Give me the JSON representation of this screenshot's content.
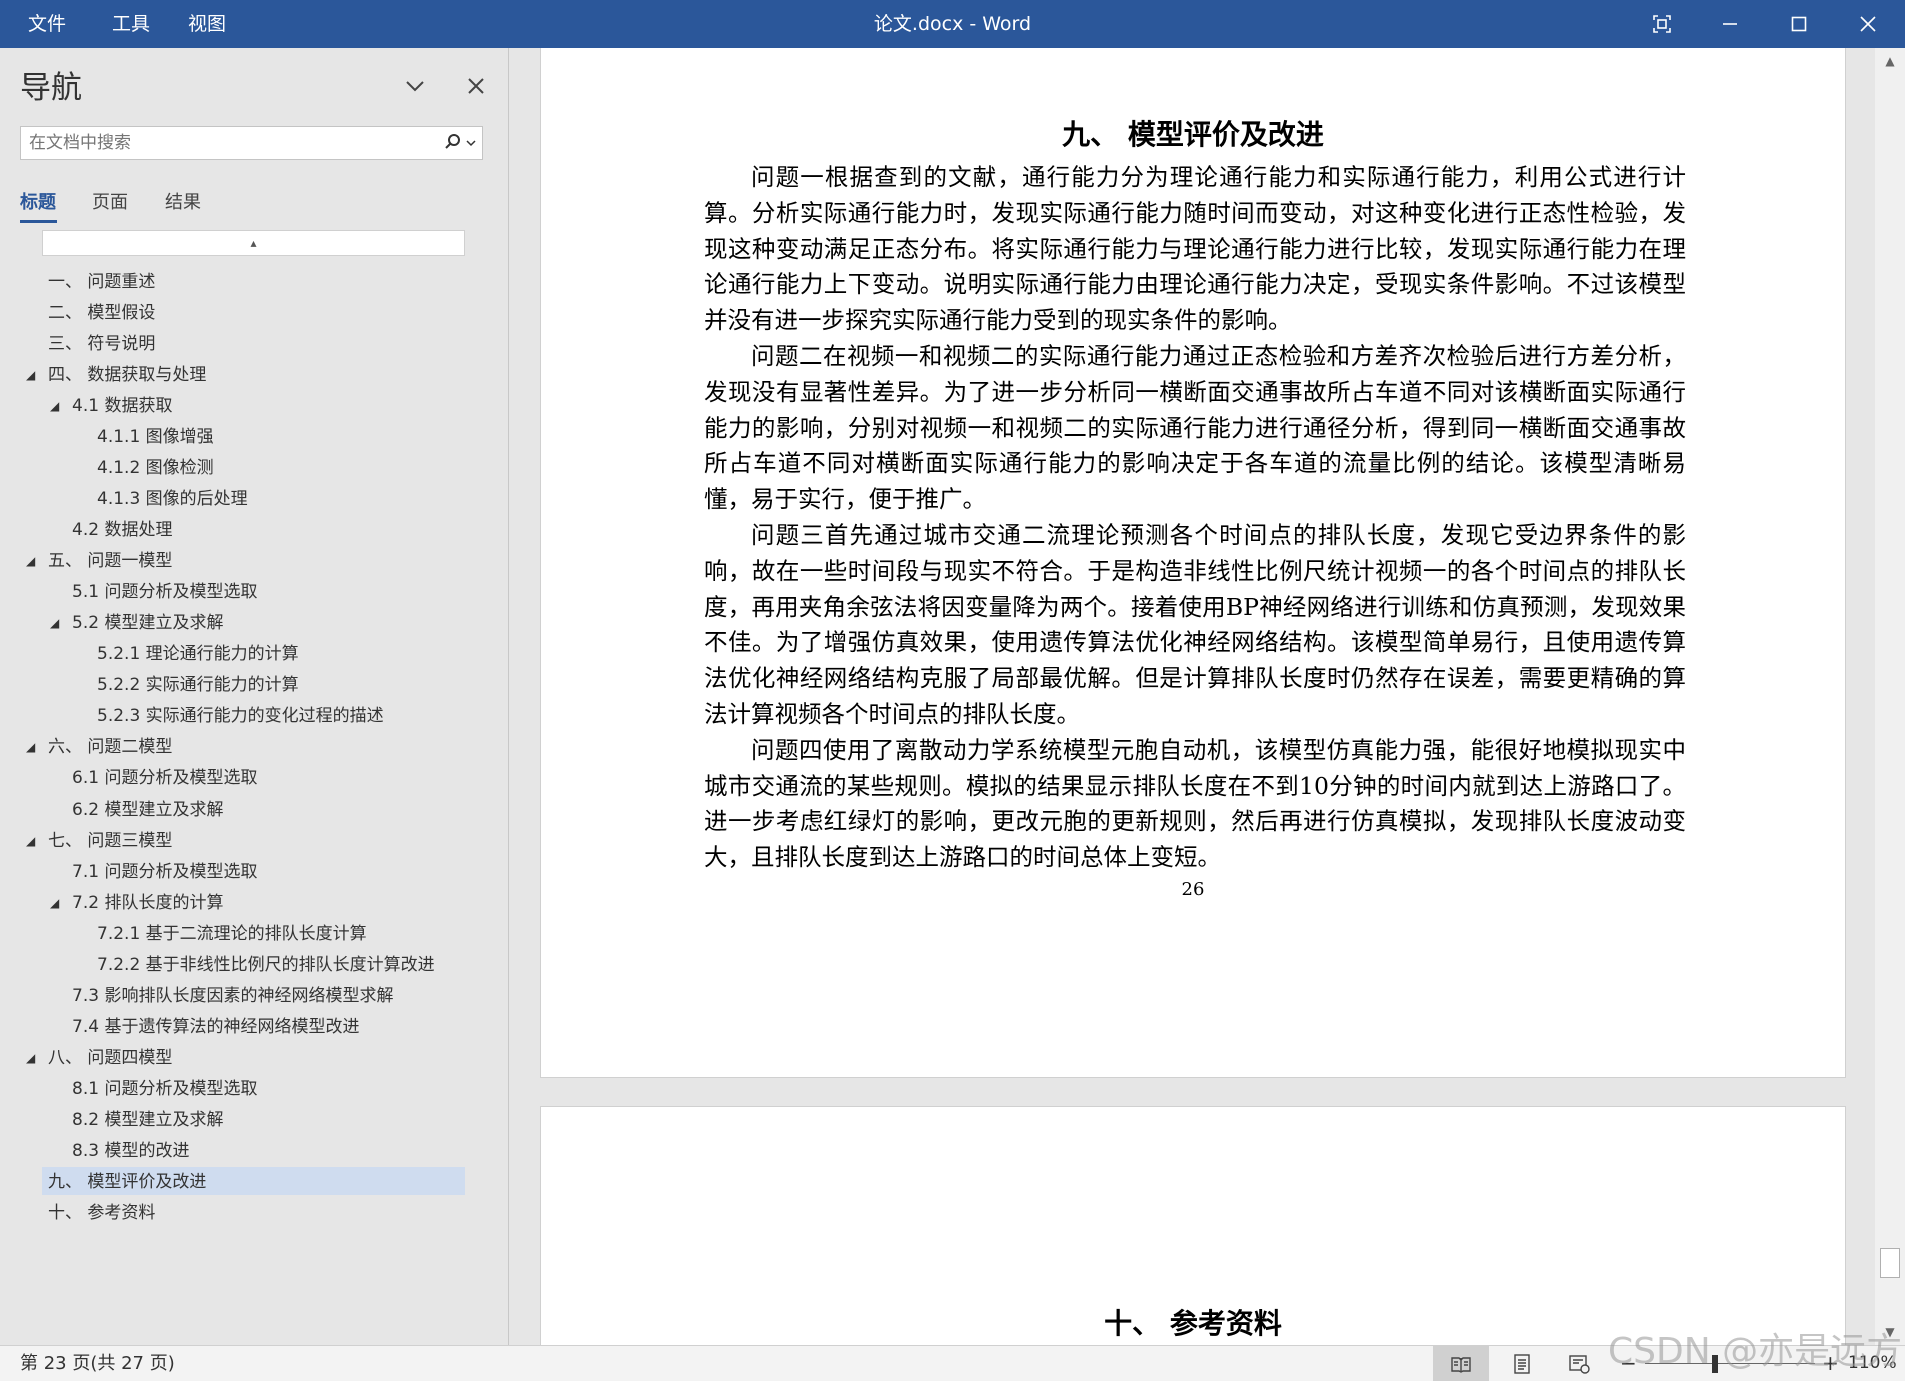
{
  "titlebar": {
    "menus": [
      "文件",
      "工具",
      "视图"
    ],
    "title": "论文.docx  -  Word"
  },
  "nav": {
    "title": "导航",
    "search_placeholder": "在文档中搜索",
    "tabs": [
      "标题",
      "页面",
      "结果"
    ],
    "active_tab": "标题",
    "collapse_glyph": "▴",
    "items": [
      {
        "label": "一、 问题重述",
        "level": 1,
        "expandable": false,
        "selected": false
      },
      {
        "label": "二、 模型假设",
        "level": 1,
        "expandable": false,
        "selected": false
      },
      {
        "label": "三、 符号说明",
        "level": 1,
        "expandable": false,
        "selected": false
      },
      {
        "label": "四、 数据获取与处理",
        "level": 1,
        "expandable": true,
        "selected": false
      },
      {
        "label": "4.1 数据获取",
        "level": 2,
        "expandable": true,
        "selected": false
      },
      {
        "label": "4.1.1 图像增强",
        "level": 3,
        "expandable": false,
        "selected": false
      },
      {
        "label": "4.1.2 图像检测",
        "level": 3,
        "expandable": false,
        "selected": false
      },
      {
        "label": "4.1.3 图像的后处理",
        "level": 3,
        "expandable": false,
        "selected": false
      },
      {
        "label": "4.2 数据处理",
        "level": 2,
        "expandable": false,
        "selected": false
      },
      {
        "label": "五、 问题一模型",
        "level": 1,
        "expandable": true,
        "selected": false
      },
      {
        "label": "5.1 问题分析及模型选取",
        "level": 2,
        "expandable": false,
        "selected": false
      },
      {
        "label": "5.2 模型建立及求解",
        "level": 2,
        "expandable": true,
        "selected": false
      },
      {
        "label": "5.2.1 理论通行能力的计算",
        "level": 3,
        "expandable": false,
        "selected": false
      },
      {
        "label": "5.2.2 实际通行能力的计算",
        "level": 3,
        "expandable": false,
        "selected": false
      },
      {
        "label": "5.2.3 实际通行能力的变化过程的描述",
        "level": 3,
        "expandable": false,
        "selected": false
      },
      {
        "label": "六、 问题二模型",
        "level": 1,
        "expandable": true,
        "selected": false
      },
      {
        "label": "6.1 问题分析及模型选取",
        "level": 2,
        "expandable": false,
        "selected": false
      },
      {
        "label": "6.2 模型建立及求解",
        "level": 2,
        "expandable": false,
        "selected": false
      },
      {
        "label": "七、 问题三模型",
        "level": 1,
        "expandable": true,
        "selected": false
      },
      {
        "label": "7.1 问题分析及模型选取",
        "level": 2,
        "expandable": false,
        "selected": false
      },
      {
        "label": "7.2 排队长度的计算",
        "level": 2,
        "expandable": true,
        "selected": false
      },
      {
        "label": "7.2.1 基于二流理论的排队长度计算",
        "level": 3,
        "expandable": false,
        "selected": false
      },
      {
        "label": "7.2.2 基于非线性比例尺的排队长度计算改进",
        "level": 3,
        "expandable": false,
        "selected": false
      },
      {
        "label": "7.3 影响排队长度因素的神经网络模型求解",
        "level": 2,
        "expandable": false,
        "selected": false
      },
      {
        "label": "7.4 基于遗传算法的神经网络模型改进",
        "level": 2,
        "expandable": false,
        "selected": false
      },
      {
        "label": "八、 问题四模型",
        "level": 1,
        "expandable": true,
        "selected": false
      },
      {
        "label": "8.1 问题分析及模型选取",
        "level": 2,
        "expandable": false,
        "selected": false
      },
      {
        "label": "8.2 模型建立及求解",
        "level": 2,
        "expandable": false,
        "selected": false
      },
      {
        "label": "8.3 模型的改进",
        "level": 2,
        "expandable": false,
        "selected": false
      },
      {
        "label": "九、 模型评价及改进",
        "level": 1,
        "expandable": false,
        "selected": true
      },
      {
        "label": "十、 参考资料",
        "level": 1,
        "expandable": false,
        "selected": false
      }
    ]
  },
  "document": {
    "page1": {
      "heading": "九、 模型评价及改进",
      "paragraphs": [
        "问题一根据查到的文献，通行能力分为理论通行能力和实际通行能力，利用公式进行计算。分析实际通行能力时，发现实际通行能力随时间而变动，对这种变化进行正态性检验，发现这种变动满足正态分布。将实际通行能力与理论通行能力进行比较，发现实际通行能力在理论通行能力上下变动。说明实际通行能力由理论通行能力决定，受现实条件影响。不过该模型并没有进一步探究实际通行能力受到的现实条件的影响。",
        "问题二在视频一和视频二的实际通行能力通过正态检验和方差齐次检验后进行方差分析，发现没有显著性差异。为了进一步分析同一横断面交通事故所占车道不同对该横断面实际通行能力的影响，分别对视频一和视频二的实际通行能力进行通径分析，得到同一横断面交通事故所占车道不同对横断面实际通行能力的影响决定于各车道的流量比例的结论。该模型清晰易懂，易于实行，便于推广。",
        "问题三首先通过城市交通二流理论预测各个时间点的排队长度，发现它受边界条件的影响，故在一些时间段与现实不符合。于是构造非线性比例尺统计视频一的各个时间点的排队长度，再用夹角余弦法将因变量降为两个。接着使用BP神经网络进行训练和仿真预测，发现效果不佳。为了增强仿真效果，使用遗传算法优化神经网络结构。该模型简单易行，且使用遗传算法优化神经网络结构克服了局部最优解。但是计算排队长度时仍然存在误差，需要更精确的算法计算视频各个时间点的排队长度。",
        "问题四使用了离散动力学系统模型元胞自动机，该模型仿真能力强，能很好地模拟现实中城市交通流的某些规则。模拟的结果显示排队长度在不到10分钟的时间内就到达上游路口了。进一步考虑红绿灯的影响，更改元胞的更新规则，然后再进行仿真模拟，发现排队长度波动变大，且排队长度到达上游路口的时间总体上变短。"
      ],
      "page_number": "26"
    },
    "page2": {
      "heading": "十、 参考资料"
    }
  },
  "statusbar": {
    "page_status": "第 23 页(共 27 页)",
    "zoom_minus": "−",
    "zoom_plus": "+",
    "zoom": "110%",
    "active_view": "read-mode"
  },
  "watermark": "CSDN @亦是远方",
  "colors": {
    "titlebar": "#2b579a",
    "selected_item": "#cfdcef",
    "pane_bg": "#e6e6e6"
  }
}
